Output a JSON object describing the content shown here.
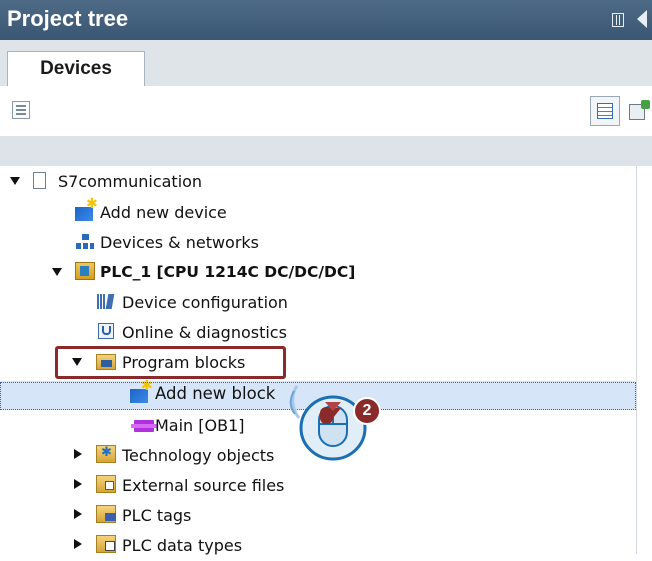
{
  "window": {
    "title": "Project tree"
  },
  "tabs": [
    {
      "label": "Devices"
    }
  ],
  "tree": {
    "project": "S7communication",
    "add_new_device": "Add new device",
    "devices_networks": "Devices & networks",
    "plc": "PLC_1 [CPU 1214C DC/DC/DC]",
    "device_configuration": "Device configuration",
    "online_diagnostics": "Online & diagnostics",
    "program_blocks": "Program blocks",
    "add_new_block": "Add new block",
    "main_ob1": "Main [OB1]",
    "technology_objects": "Technology objects",
    "external_source_files": "External source files",
    "plc_tags": "PLC tags",
    "plc_data_types": "PLC data types"
  },
  "callout": {
    "number": "2"
  },
  "colors": {
    "titlebar": "#3a5672",
    "highlight": "#8a2a2a",
    "selection": "#d6e6f8"
  },
  "icons": [
    "panel-layout-icon",
    "collapse-arrow-icon",
    "project-icon",
    "add-device-icon",
    "network-icon",
    "plc-icon",
    "device-config-icon",
    "online-diagnostics-icon",
    "folder-blocks-icon",
    "add-block-icon",
    "ob-block-icon",
    "technology-icon",
    "source-files-icon",
    "tags-icon",
    "data-types-icon",
    "mouse-click-icon"
  ]
}
